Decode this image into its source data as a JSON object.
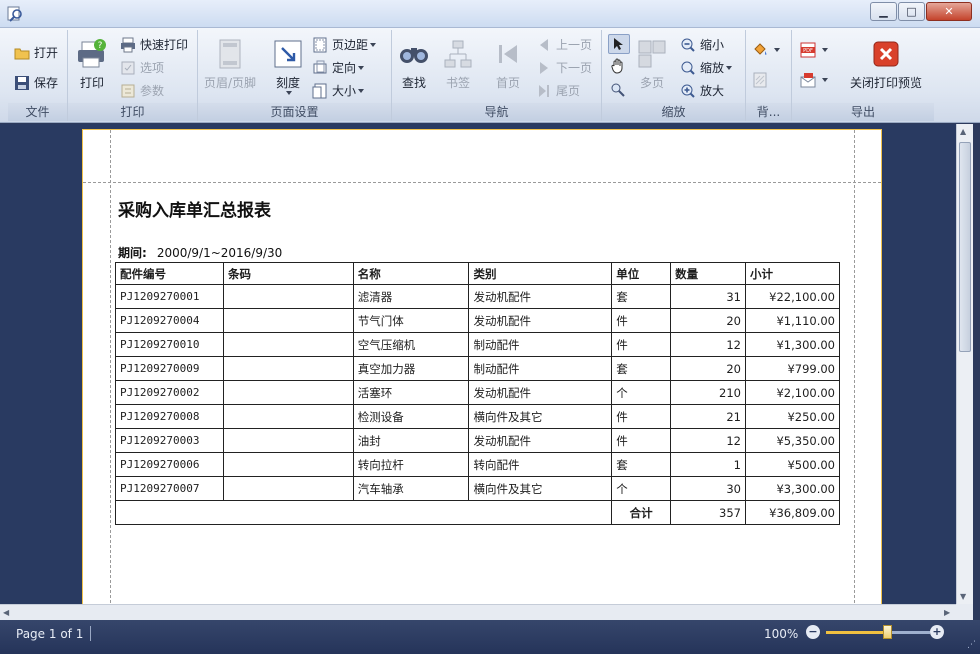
{
  "window": {
    "minimize": "▁",
    "maximize": "□",
    "close": "✕"
  },
  "ribbon": {
    "file_group": {
      "label": "文件",
      "open": "打开",
      "save": "保存"
    },
    "print_group": {
      "label": "打印",
      "print": "打印",
      "quick_print": "快速打印",
      "options": "选项",
      "params": "参数"
    },
    "page_setup_group": {
      "label": "页面设置",
      "header_footer": "页眉/页脚",
      "scale": "刻度",
      "margins": "页边距",
      "orientation": "定向",
      "size": "大小"
    },
    "nav_group": {
      "label": "导航",
      "find": "查找",
      "bookmark": "书签",
      "first": "首页",
      "prev": "上一页",
      "next": "下一页",
      "last": "尾页"
    },
    "zoom_group": {
      "label": "缩放",
      "multi_page": "多页",
      "zoom_out": "缩小",
      "zoom": "缩放",
      "zoom_in": "放大"
    },
    "background_group": {
      "label": "背..."
    },
    "export_group": {
      "label": "导出",
      "close_preview": "关闭打印预览"
    }
  },
  "report": {
    "title": "采购入库单汇总报表",
    "period_label": "期间:",
    "period_value": "2000/9/1~2016/9/30",
    "headers": [
      "配件编号",
      "条码",
      "名称",
      "类别",
      "单位",
      "数量",
      "小计"
    ],
    "rows": [
      [
        "PJ1209270001",
        "",
        "滤清器",
        "发动机配件",
        "套",
        "31",
        "¥22,100.00"
      ],
      [
        "PJ1209270004",
        "",
        "节气门体",
        "发动机配件",
        "件",
        "20",
        "¥1,110.00"
      ],
      [
        "PJ1209270010",
        "",
        "空气压缩机",
        "制动配件",
        "件",
        "12",
        "¥1,300.00"
      ],
      [
        "PJ1209270009",
        "",
        "真空加力器",
        "制动配件",
        "套",
        "20",
        "¥799.00"
      ],
      [
        "PJ1209270002",
        "",
        "活塞环",
        "发动机配件",
        "个",
        "210",
        "¥2,100.00"
      ],
      [
        "PJ1209270008",
        "",
        "检测设备",
        "横向件及其它",
        "件",
        "21",
        "¥250.00"
      ],
      [
        "PJ1209270003",
        "",
        "油封",
        "发动机配件",
        "件",
        "12",
        "¥5,350.00"
      ],
      [
        "PJ1209270006",
        "",
        "转向拉杆",
        "转向配件",
        "套",
        "1",
        "¥500.00"
      ],
      [
        "PJ1209270007",
        "",
        "汽车轴承",
        "横向件及其它",
        "个",
        "30",
        "¥3,300.00"
      ]
    ],
    "total_label": "合计",
    "total_qty": "357",
    "total_amount": "¥36,809.00"
  },
  "status": {
    "page_info": "Page 1 of 1",
    "zoom": "100%",
    "zoom_minus": "−",
    "zoom_plus": "+",
    "zoom_level": 0.6
  },
  "colors": {
    "accent": "#f0c040",
    "status_bg": "#2d3a5c",
    "close_red": "#c4432c"
  }
}
